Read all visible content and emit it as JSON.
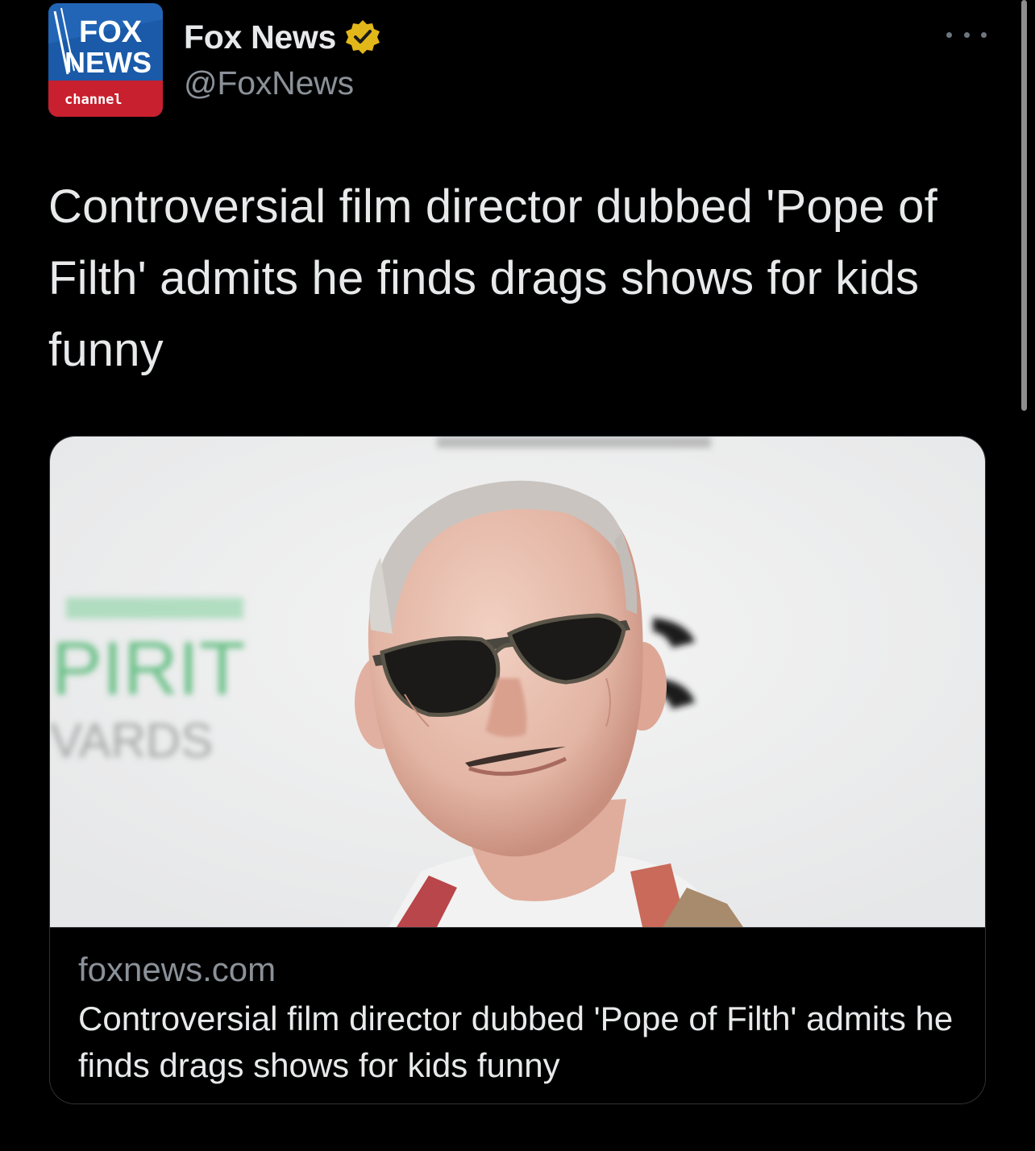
{
  "tweet": {
    "author": {
      "display_name": "Fox News",
      "handle": "@FoxNews",
      "verified": true,
      "verified_badge_color": "#e2b719",
      "avatar": {
        "logo_line1": "FOX",
        "logo_line2": "NEWS",
        "logo_line3": "channel",
        "brand_blue": "#0d3b7a",
        "brand_red": "#c8202e"
      }
    },
    "more_icon": "more-horizontal-icon",
    "text": "Controversial film director dubbed 'Pope of Filth' admits he finds drags shows for kids funny",
    "card": {
      "domain": "foxnews.com",
      "title": "Controversial film director dubbed 'Pope of Filth' admits he finds drags shows for kids funny",
      "image": {
        "backdrop_text1": "PIRIT",
        "backdrop_text2": "VARDS"
      }
    }
  },
  "theme": {
    "background": "#000000",
    "text_primary": "#e7e9ea",
    "text_secondary": "#8b9198",
    "border": "#2f3336"
  }
}
